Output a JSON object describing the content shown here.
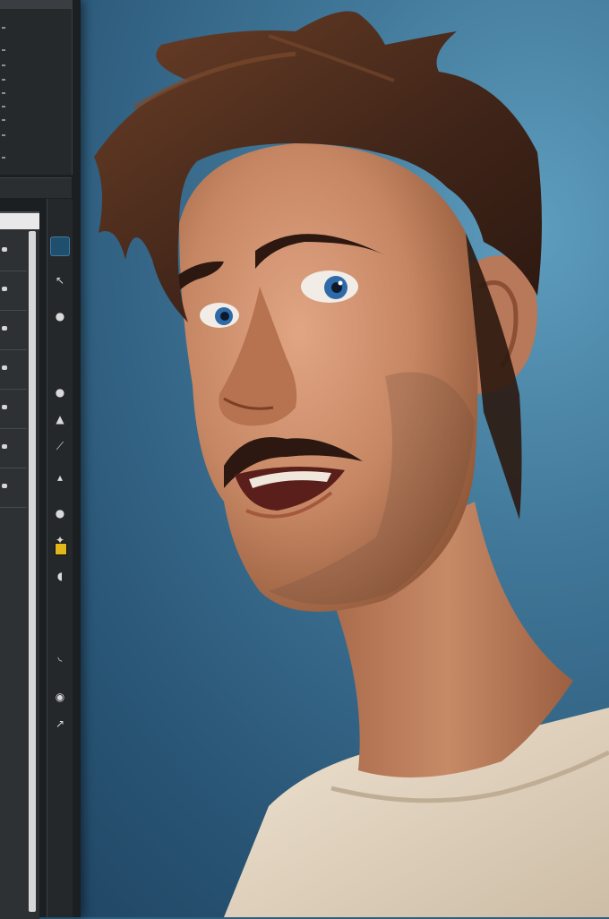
{
  "app": {
    "colors": {
      "background_light": "#5e9dbe",
      "background_dark": "#1e4360",
      "panel": "#1c1f22",
      "accent_swatch": "#e0b81c",
      "skin": "#c98a68",
      "hair": "#4a2a1b",
      "shirt": "#e4d6c2",
      "eye": "#2f6aa8"
    }
  },
  "tools": [
    {
      "name": "move-tool-icon",
      "glyph": "↖"
    },
    {
      "name": "brush-tool-icon",
      "glyph": "●"
    },
    {
      "name": "eraser-tool-icon",
      "glyph": "●"
    },
    {
      "name": "pen-tool-icon",
      "glyph": "▲"
    },
    {
      "name": "smudge-tool-icon",
      "glyph": "⟋"
    },
    {
      "name": "fill-tool-icon",
      "glyph": "▴"
    },
    {
      "name": "dodge-tool-icon",
      "glyph": "●"
    },
    {
      "name": "selection-tool-icon",
      "glyph": "✦"
    },
    {
      "name": "lasso-tool-icon",
      "glyph": "◖"
    },
    {
      "name": "hand-tool-icon",
      "glyph": "◟"
    },
    {
      "name": "zoom-tool-icon",
      "glyph": "◉"
    },
    {
      "name": "eyedropper-tool-icon",
      "glyph": "↗"
    }
  ]
}
